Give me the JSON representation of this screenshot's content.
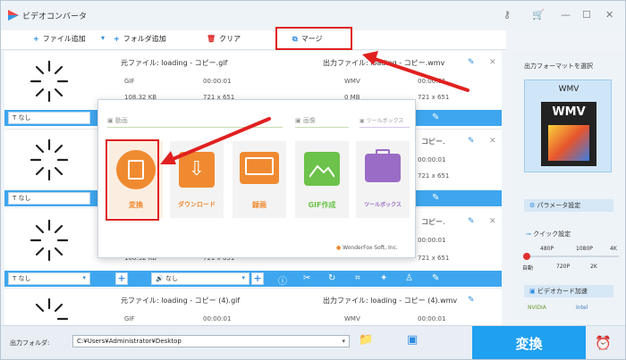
{
  "app": {
    "title": "ビデオコンバータ"
  },
  "toolbar": {
    "add_file": "ファイル追加",
    "add_folder": "フォルダ追加",
    "clear": "クリア",
    "merge": "マージ"
  },
  "rows": [
    {
      "source": "元ファイル: loading - コピー.gif",
      "src_format": "GIF",
      "src_duration": "00:00:01",
      "src_size": "108.32 KB",
      "src_res": "721 x 651",
      "output": "出力ファイル: loading - コピー.wmv",
      "out_format": "WMV",
      "out_duration": "00:00:01",
      "out_size": "0 MB",
      "out_res": "721 x 651",
      "subtitle": "なし"
    },
    {
      "output": "コピー.",
      "out_duration": "00:00:01",
      "out_res": "721 x 651",
      "subtitle": "なし"
    },
    {
      "output": "コピー.",
      "out_duration": "00:00:01",
      "src_size": "108.32 KB",
      "src_res": "721 x 651",
      "out_res": "721 x 651",
      "subtitle": "なし",
      "audio": "なし"
    },
    {
      "source": "元ファイル: loading - コピー (4).gif",
      "src_format": "GIF",
      "src_duration": "00:00:01",
      "output": "出力ファイル: loading - コピー (4).wmv",
      "out_format": "WMV",
      "out_duration": "00:00:01"
    }
  ],
  "popup": {
    "section_video": "動画",
    "section_image": "画像",
    "section_toolbox": "ツールボックス",
    "tiles": [
      "変換",
      "ダウンロード",
      "録画",
      "GIF作成",
      "ツールボックス"
    ],
    "brand": "WonderFox Soft, Inc."
  },
  "right_panel": {
    "select_format": "出力フォーマットを選択",
    "format": "WMV",
    "format_badge": "WMV",
    "param_settings": "パラメータ設定",
    "quick_settings": "クイック設定",
    "quality_top": [
      "480P",
      "1080P",
      "4K"
    ],
    "quality_bottom": [
      "自動",
      "720P",
      "2K"
    ],
    "gpu_accel": "ビデオカード加速",
    "gpu_brands": [
      "NVIDIA",
      "Intel"
    ]
  },
  "bottom": {
    "output_folder_label": "出力フォルダ:",
    "output_path": "C:¥Users¥Administrator¥Desktop",
    "run_button": "変換"
  },
  "colors": {
    "accent": "#20a0f0",
    "highlight": "#e02020",
    "tile_orange": "#f08a30",
    "tile_green": "#6cc24a",
    "tile_purple": "#9b6cc6"
  }
}
